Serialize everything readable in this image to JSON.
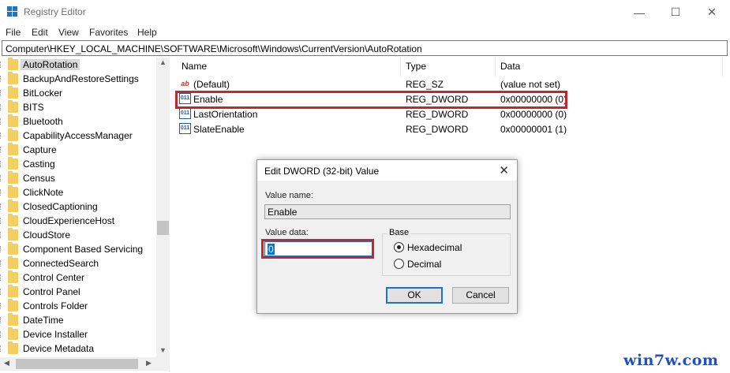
{
  "window": {
    "title": "Registry Editor",
    "controls": {
      "minimize": "—",
      "maximize": "☐",
      "close": "✕"
    }
  },
  "menu": [
    "File",
    "Edit",
    "View",
    "Favorites",
    "Help"
  ],
  "address": "Computer\\HKEY_LOCAL_MACHINE\\SOFTWARE\\Microsoft\\Windows\\CurrentVersion\\AutoRotation",
  "tree": {
    "selected": "AutoRotation",
    "items": [
      "AutoRotation",
      "BackupAndRestoreSettings",
      "BitLocker",
      "BITS",
      "Bluetooth",
      "CapabilityAccessManager",
      "Capture",
      "Casting",
      "Census",
      "ClickNote",
      "ClosedCaptioning",
      "CloudExperienceHost",
      "CloudStore",
      "Component Based Servicing",
      "ConnectedSearch",
      "Control Center",
      "Control Panel",
      "Controls Folder",
      "DateTime",
      "Device Installer",
      "Device Metadata"
    ]
  },
  "list": {
    "columns": {
      "name": "Name",
      "type": "Type",
      "data": "Data"
    },
    "rows": [
      {
        "icon": "string-value-icon",
        "glyph": "ab",
        "name": "(Default)",
        "type": "REG_SZ",
        "data": "(value not set)"
      },
      {
        "icon": "dword-value-icon",
        "glyph": "011",
        "name": "Enable",
        "type": "REG_DWORD",
        "data": "0x00000000 (0)"
      },
      {
        "icon": "dword-value-icon",
        "glyph": "011",
        "name": "LastOrientation",
        "type": "REG_DWORD",
        "data": "0x00000000 (0)"
      },
      {
        "icon": "dword-value-icon",
        "glyph": "011",
        "name": "SlateEnable",
        "type": "REG_DWORD",
        "data": "0x00000001 (1)"
      }
    ]
  },
  "dialog": {
    "title": "Edit DWORD (32-bit) Value",
    "close": "✕",
    "value_name_label": "Value name:",
    "value_name": "Enable",
    "value_data_label": "Value data:",
    "value_data": "0",
    "base_label": "Base",
    "base_options": [
      "Hexadecimal",
      "Decimal"
    ],
    "base_selected": "Hexadecimal",
    "ok": "OK",
    "cancel": "Cancel"
  },
  "highlight_color": "#c1272d",
  "watermark": "win7w.com"
}
